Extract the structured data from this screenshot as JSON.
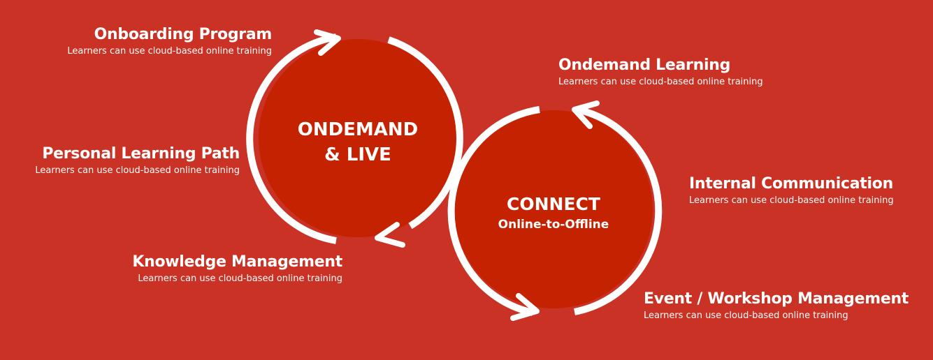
{
  "colors": {
    "background": "#c93224",
    "circle_fill": "#c42200",
    "ring": "#ffffff",
    "text": "#ffffff"
  },
  "circles": {
    "left": {
      "line1": "ONDEMAND",
      "line2": "& LIVE"
    },
    "right": {
      "line1": "CONNECT",
      "line2": "Online-to-Offline"
    }
  },
  "items_left": [
    {
      "title": "Onboarding Program",
      "desc": "Learners can use cloud-based online training"
    },
    {
      "title": "Personal Learning Path",
      "desc": "Learners can use cloud-based online training"
    },
    {
      "title": "Knowledge Management",
      "desc": "Learners can use cloud-based online training"
    }
  ],
  "items_right": [
    {
      "title": "Ondemand Learning",
      "desc": "Learners can use cloud-based online training"
    },
    {
      "title": "Internal Communication",
      "desc": "Learners can use cloud-based online training"
    },
    {
      "title": "Event / Workshop Management",
      "desc": "Learners can use cloud-based online training"
    }
  ]
}
